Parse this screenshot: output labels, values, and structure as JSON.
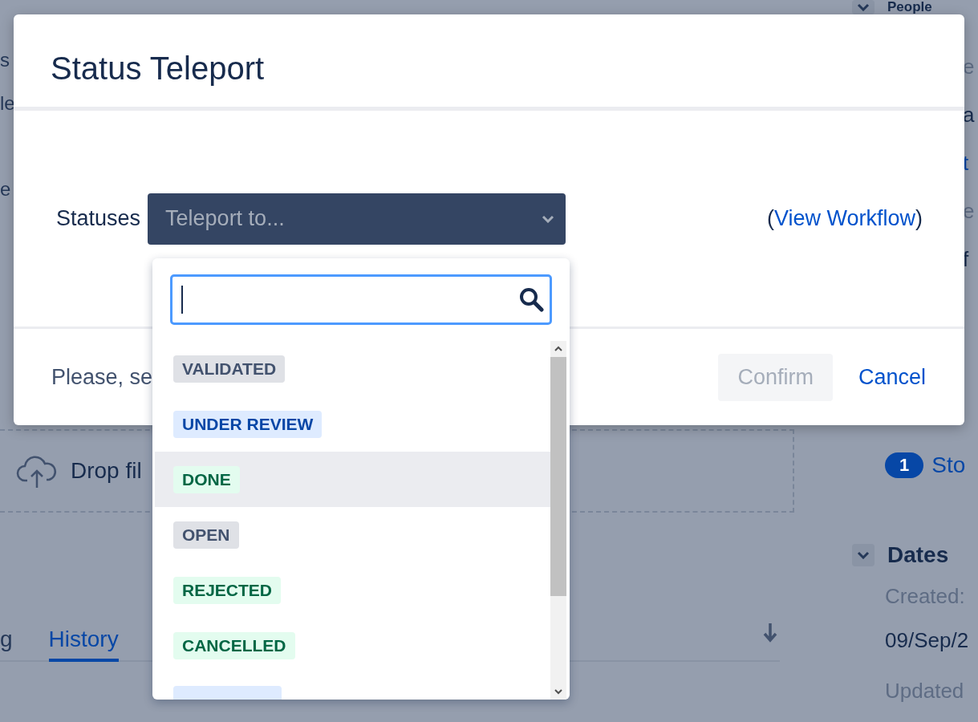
{
  "background": {
    "left_fragments": [
      "s",
      "le",
      "e"
    ],
    "drop_zone": {
      "text": "Drop fil"
    },
    "tabs": [
      {
        "label": "g",
        "selected": false
      },
      {
        "label": "History",
        "selected": true
      }
    ],
    "sidebar": {
      "people_heading": "People",
      "fragments": [
        {
          "text": "e",
          "kind": "muted"
        },
        {
          "text": "a",
          "kind": "plain"
        },
        {
          "text": "t",
          "kind": "link"
        },
        {
          "text": "e",
          "kind": "muted"
        },
        {
          "text": "f",
          "kind": "plain"
        }
      ],
      "watch_count": "1",
      "watch_link": "Sto",
      "dates_heading": "Dates",
      "created_label": "Created:",
      "created_value": "09/Sep/2",
      "updated_label": "Updated"
    }
  },
  "dialog": {
    "title": "Status Teleport",
    "field_label": "Statuses",
    "select": {
      "placeholder": "Teleport to..."
    },
    "link_open": "(",
    "link": "View Workflow",
    "link_close": ")",
    "footer_text": "Please, se",
    "confirm": {
      "label": "Confirm",
      "disabled": true
    },
    "cancel": "Cancel"
  },
  "dropdown": {
    "items": [
      {
        "label": "VALIDATED",
        "kind": "new",
        "selected": false
      },
      {
        "label": "UNDER REVIEW",
        "kind": "inprogress",
        "selected": false
      },
      {
        "label": "DONE",
        "kind": "done",
        "selected": true
      },
      {
        "label": "OPEN",
        "kind": "new",
        "selected": false
      },
      {
        "label": "REJECTED",
        "kind": "done",
        "selected": false
      },
      {
        "label": "CANCELLED",
        "kind": "done",
        "selected": false
      },
      {
        "kind": "inprogress",
        "selected": false
      }
    ]
  }
}
